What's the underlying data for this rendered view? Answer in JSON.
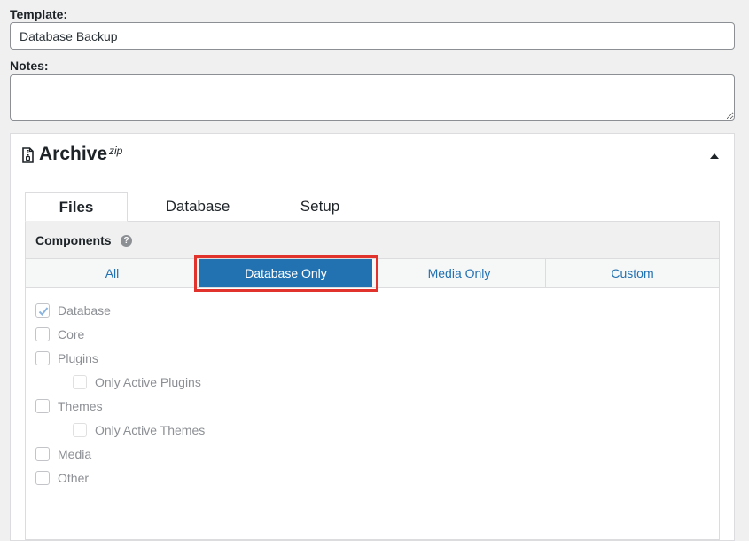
{
  "form": {
    "template_label": "Template:",
    "template_value": "Database Backup",
    "notes_label": "Notes:",
    "notes_value": ""
  },
  "panel": {
    "title": "Archive",
    "title_sup": "zip",
    "icon": "file-zip-icon",
    "collapse_icon": "triangle-up-icon"
  },
  "tabs": [
    {
      "label": "Files",
      "active": true
    },
    {
      "label": "Database",
      "active": false
    },
    {
      "label": "Setup",
      "active": false
    }
  ],
  "components": {
    "label": "Components",
    "help_icon": "?",
    "filters": [
      {
        "label": "All"
      },
      {
        "label": "Database Only",
        "selected": true
      },
      {
        "label": "Media Only"
      },
      {
        "label": "Custom"
      }
    ],
    "items": [
      {
        "label": "Database",
        "checked": true
      },
      {
        "label": "Core",
        "checked": false
      },
      {
        "label": "Plugins",
        "checked": false
      },
      {
        "label": "Only Active Plugins",
        "checked": false,
        "indent": true
      },
      {
        "label": "Themes",
        "checked": false
      },
      {
        "label": "Only Active Themes",
        "checked": false,
        "indent": true
      },
      {
        "label": "Media",
        "checked": false
      },
      {
        "label": "Other",
        "checked": false
      }
    ]
  },
  "colors": {
    "accent": "#2271b1",
    "highlight": "#e1322b"
  }
}
